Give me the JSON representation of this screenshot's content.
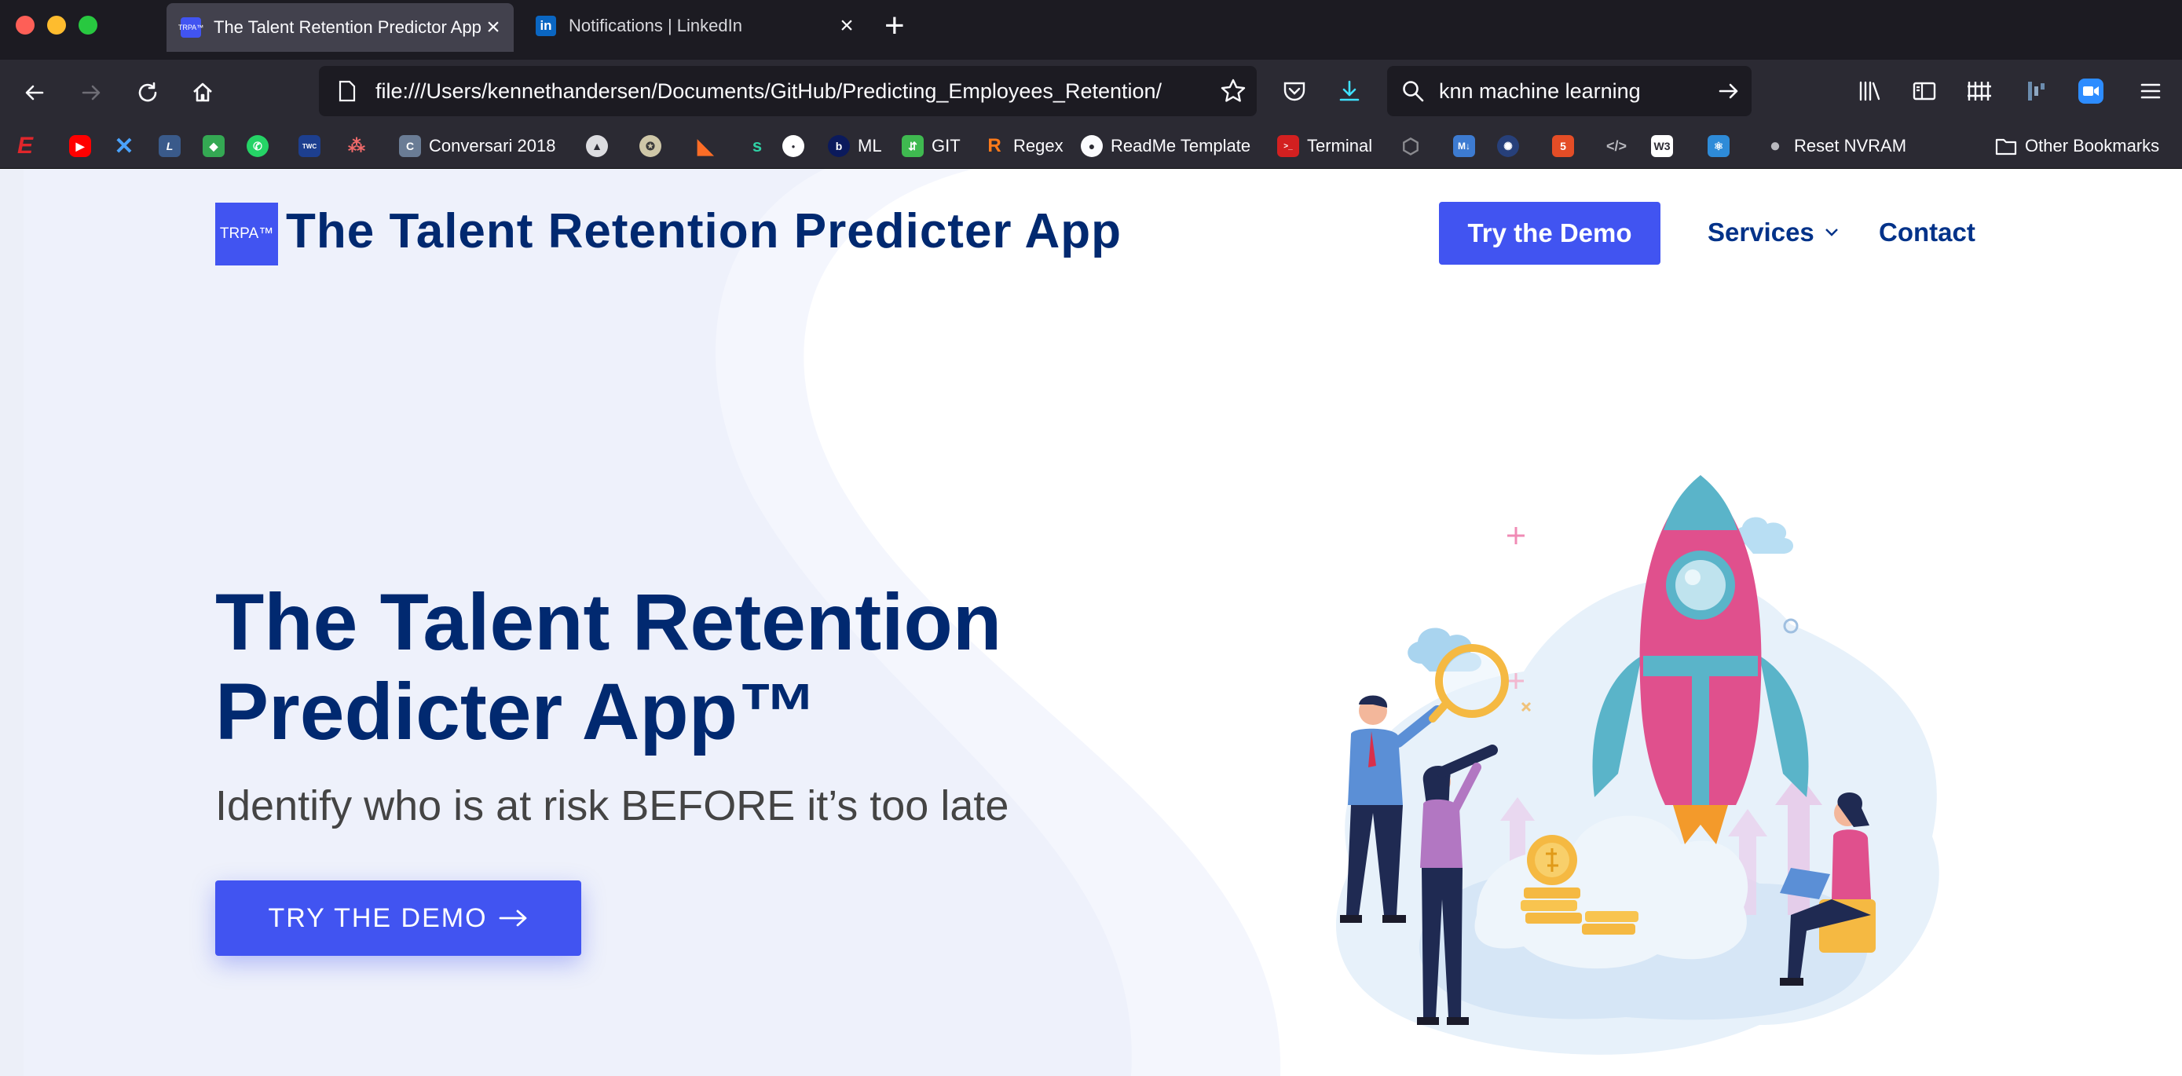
{
  "browser": {
    "tabs": [
      {
        "title": "The Talent Retention Predictor App",
        "favicon": "TRPA"
      },
      {
        "title": "Notifications | LinkedIn",
        "favicon": "in"
      }
    ],
    "url": "file:///Users/kennethandersen/Documents/GitHub/Predicting_Employees_Retention/",
    "search_value": "knn machine learning",
    "bookmarks": [
      {
        "label": "",
        "icon": "red-e-icon"
      },
      {
        "label": "",
        "icon": "youtube-icon"
      },
      {
        "label": "",
        "icon": "x-icon"
      },
      {
        "label": "",
        "icon": "l-icon"
      },
      {
        "label": "",
        "icon": "maps-icon"
      },
      {
        "label": "",
        "icon": "whatsapp-icon"
      },
      {
        "label": "",
        "icon": "weather-channel-icon"
      },
      {
        "label": "",
        "icon": "asana-icon"
      },
      {
        "label": "Conversari 2018",
        "icon": "conversari-icon"
      },
      {
        "label": "",
        "icon": "circle-a-icon"
      },
      {
        "label": "",
        "icon": "seal-icon"
      },
      {
        "label": "",
        "icon": "gitlab-icon"
      },
      {
        "label": "",
        "icon": "s-icon"
      },
      {
        "label": "",
        "icon": "circle-icon"
      },
      {
        "label": "ML",
        "icon": "b-icon"
      },
      {
        "label": "GIT",
        "icon": "git-icon"
      },
      {
        "label": "Regex",
        "icon": "regex-icon"
      },
      {
        "label": "ReadMe Template",
        "icon": "github-icon"
      },
      {
        "label": "Terminal",
        "icon": "terminal-icon"
      },
      {
        "label": "",
        "icon": "hex-icon"
      },
      {
        "label": "",
        "icon": "m-icon"
      },
      {
        "label": "",
        "icon": "emblem-icon"
      },
      {
        "label": "",
        "icon": "html5-icon"
      },
      {
        "label": "",
        "icon": "code-icon"
      },
      {
        "label": "",
        "icon": "w3-icon"
      },
      {
        "label": "",
        "icon": "react-icon"
      },
      {
        "label": "Reset NVRAM",
        "icon": "apple-icon"
      }
    ],
    "other_bookmarks": "Other Bookmarks"
  },
  "site": {
    "logo_badge": "TRPA™",
    "logo_text": "The Talent Retention Predicter App",
    "nav": {
      "demo": "Try the Demo",
      "services": "Services",
      "contact": "Contact"
    },
    "hero": {
      "title": "The Talent Retention Predicter App™",
      "subtitle": "Identify who is at risk BEFORE it’s too late",
      "cta": "TRY THE DEMO"
    }
  },
  "colors": {
    "brand": "#4154f1",
    "heading": "#012970",
    "chrome_dark": "#1c1b22",
    "chrome": "#2b2a33"
  }
}
